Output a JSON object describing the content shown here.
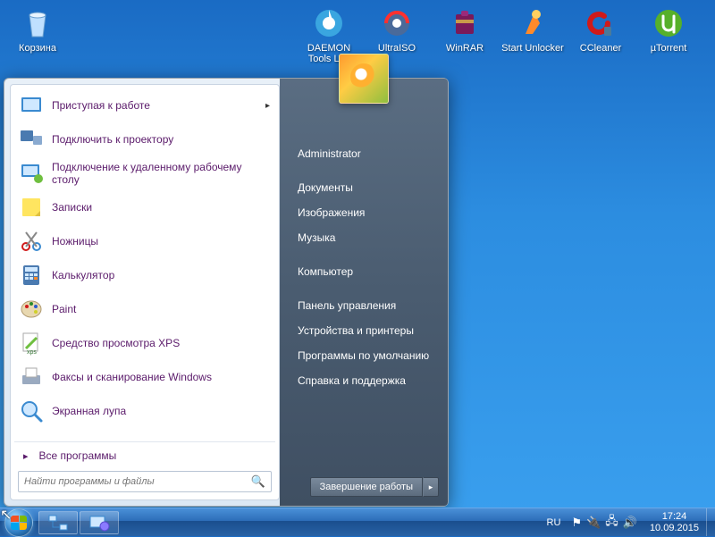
{
  "desktop": {
    "icons": [
      {
        "label": "Корзина",
        "name": "recycle-bin",
        "color": "#cfe8ff"
      },
      {
        "label": "DAEMON Tools Lite",
        "name": "daemon-tools",
        "color": "#3aa6e0"
      },
      {
        "label": "UltraISO",
        "name": "ultraiso",
        "color": "#5a7fb0"
      },
      {
        "label": "WinRAR",
        "name": "winrar",
        "color": "#8a2a6a"
      },
      {
        "label": "Start Unlocker",
        "name": "start-unlocker",
        "color": "#ff8a2a"
      },
      {
        "label": "CCleaner",
        "name": "ccleaner",
        "color": "#d01a1a"
      },
      {
        "label": "µTorrent",
        "name": "utorrent",
        "color": "#56b02a"
      }
    ]
  },
  "start_menu": {
    "programs": [
      {
        "label": "Приступая к работе",
        "icon": "getting-started-icon",
        "has_submenu": true
      },
      {
        "label": "Подключить к проектору",
        "icon": "projector-icon"
      },
      {
        "label": "Подключение к удаленному рабочему столу",
        "icon": "rdp-icon"
      },
      {
        "label": "Записки",
        "icon": "sticky-notes-icon"
      },
      {
        "label": "Ножницы",
        "icon": "snipping-tool-icon"
      },
      {
        "label": "Калькулятор",
        "icon": "calculator-icon"
      },
      {
        "label": "Paint",
        "icon": "paint-icon"
      },
      {
        "label": "Средство просмотра XPS",
        "icon": "xps-viewer-icon"
      },
      {
        "label": "Факсы и сканирование Windows",
        "icon": "fax-scan-icon"
      },
      {
        "label": "Экранная лупа",
        "icon": "magnifier-icon"
      }
    ],
    "all_programs": "Все программы",
    "search_placeholder": "Найти программы и файлы",
    "right": {
      "user": "Administrator",
      "items_a": [
        "Документы",
        "Изображения",
        "Музыка"
      ],
      "items_b": [
        "Компьютер"
      ],
      "items_c": [
        "Панель управления",
        "Устройства и принтеры",
        "Программы по умолчанию",
        "Справка и поддержка"
      ]
    },
    "shutdown_label": "Завершение работы"
  },
  "taskbar": {
    "lang": "RU",
    "time": "17:24",
    "date": "10.09.2015"
  }
}
